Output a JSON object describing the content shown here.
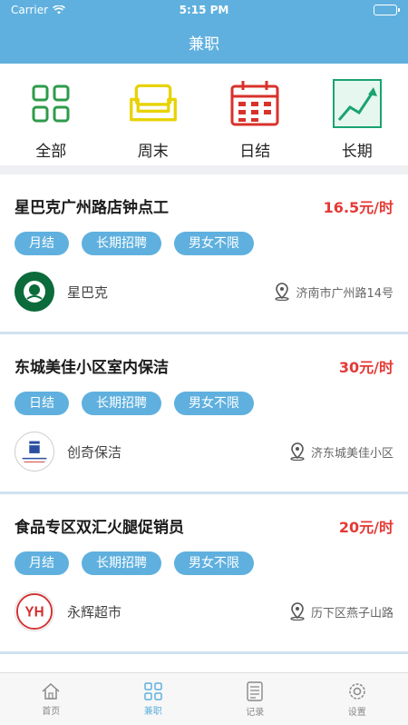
{
  "status": {
    "carrier": "Carrier",
    "time": "5:15 PM"
  },
  "nav": {
    "title": "兼职"
  },
  "categories": [
    {
      "label": "全部",
      "icon": "grid-icon"
    },
    {
      "label": "周末",
      "icon": "sofa-icon"
    },
    {
      "label": "日结",
      "icon": "calendar-icon"
    },
    {
      "label": "长期",
      "icon": "trend-chart-icon"
    }
  ],
  "jobs": [
    {
      "title": "星巴克广州路店钟点工",
      "pay": "16.5元/时",
      "tags": [
        "月结",
        "长期招聘",
        "男女不限"
      ],
      "company": "星巴克",
      "location": "济南市广州路14号",
      "logo": "starbucks-logo"
    },
    {
      "title": "东城美佳小区室内保洁",
      "pay": "30元/时",
      "tags": [
        "日结",
        "长期招聘",
        "男女不限"
      ],
      "company": "创奇保洁",
      "location": "济东城美佳小区",
      "logo": "chuangqi-logo"
    },
    {
      "title": "食品专区双汇火腿促销员",
      "pay": "20元/时",
      "tags": [
        "月结",
        "长期招聘",
        "男女不限"
      ],
      "company": "永辉超市",
      "location": "历下区燕子山路",
      "logo": "yonghui-logo",
      "logo_text": "YH"
    }
  ],
  "tabbar": [
    {
      "label": "首页",
      "icon": "home-icon",
      "active": false
    },
    {
      "label": "兼职",
      "icon": "grid-icon",
      "active": true
    },
    {
      "label": "记录",
      "icon": "list-icon",
      "active": false
    },
    {
      "label": "设置",
      "icon": "gear-icon",
      "active": false
    }
  ],
  "colors": {
    "primary": "#5fb0de",
    "pay": "#e53935",
    "grid": "#2e9b4a",
    "sofa": "#e8d200",
    "calendar": "#d8322b",
    "trend": "#1aa36f"
  }
}
